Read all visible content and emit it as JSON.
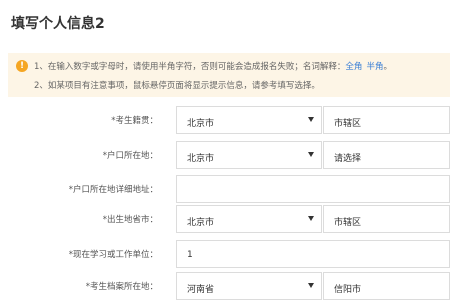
{
  "page": {
    "title": "填写个人信息2"
  },
  "notice": {
    "line1_prefix": "1、在输入数字或字母时，请使用半角字符，否则可能会造成报名失败；名词解释：",
    "term1": "全角",
    "term2": "半角",
    "line1_suffix": "。",
    "line2": "2、如某项目有注意事项，鼠标悬停页面将显示提示信息，请参考填写选择。"
  },
  "form": {
    "native_place": {
      "label": "*考生籍贯：",
      "province": "北京市",
      "city": "市辖区"
    },
    "hukou": {
      "label": "*户口所在地：",
      "province": "北京市",
      "city": "请选择"
    },
    "hukou_address": {
      "label": "*户口所在地详细地址：",
      "value": ""
    },
    "birthplace": {
      "label": "*出生地省市：",
      "province": "北京市",
      "city": "市辖区"
    },
    "work_unit": {
      "label": "*现在学习或工作单位：",
      "value": "1"
    },
    "archive": {
      "label": "*考生档案所在地：",
      "province": "河南省",
      "city": "信阳市"
    }
  }
}
